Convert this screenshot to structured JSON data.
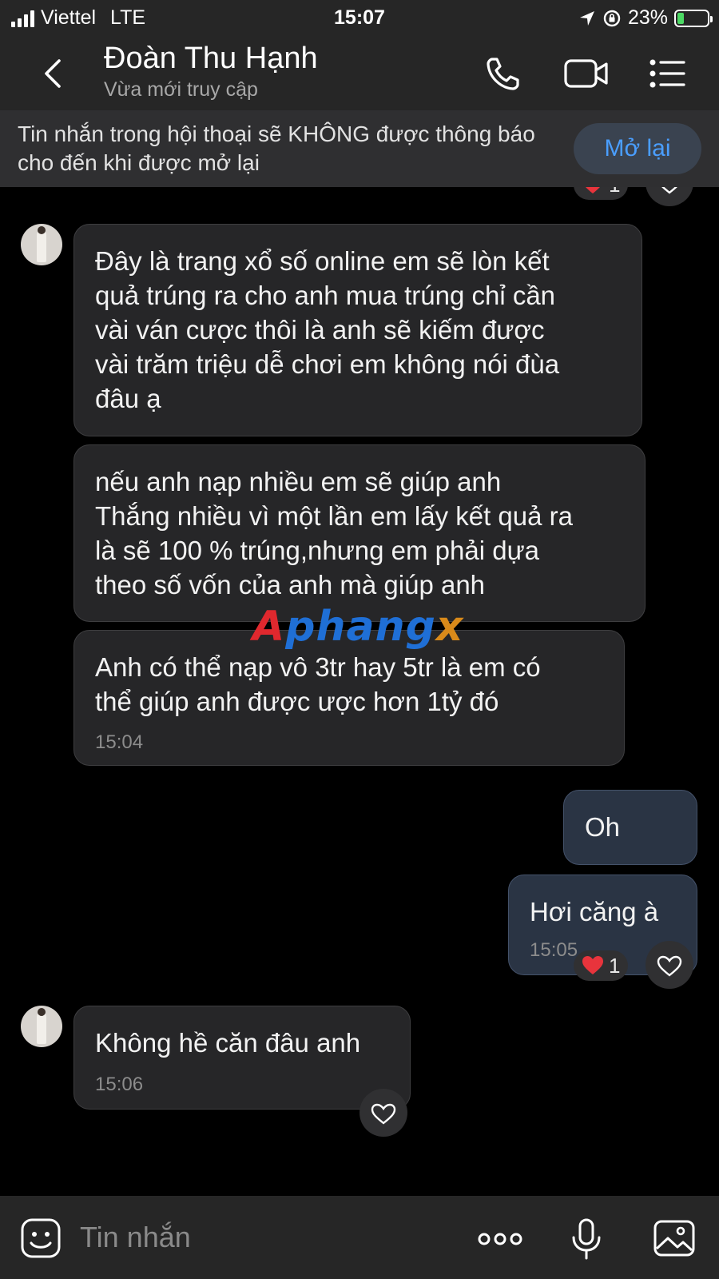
{
  "status_bar": {
    "carrier": "Viettel",
    "network": "LTE",
    "time": "15:07",
    "battery": "23%",
    "battery_level": 0.23,
    "battery_color": "#4cd964"
  },
  "header": {
    "contact_name": "Đoàn Thu Hạnh",
    "contact_status": "Vừa mới truy cập",
    "icons": [
      "back-icon",
      "phone-icon",
      "video-call-icon",
      "menu-icon"
    ]
  },
  "banner": {
    "text": "Tin nhắn trong hội thoại sẽ KHÔNG được thông báo cho đến khi được mở lại",
    "button_label": "Mở lại",
    "accent_color": "#4a9eff"
  },
  "messages": [
    {
      "direction": "incoming",
      "text": "Đây là trang xổ số online em sẽ lòn kết\nquả trúng ra cho anh mua trúng chỉ cần\nvài ván cược thôi là anh sẽ kiếm được\nvài trăm triệu dễ chơi em không nói đùa\nđâu ạ"
    },
    {
      "direction": "incoming",
      "text": "nếu anh nạp nhiều em sẽ giúp anh\nThắng nhiều vì một lần em lấy kết quả ra\nlà sẽ 100 % trúng,nhưng em phải dựa\ntheo số vốn của anh mà giúp anh"
    },
    {
      "direction": "incoming",
      "text": "Anh có thể nạp vô 3tr hay 5tr là em có\nthể giúp anh được ược hơn 1tỷ đó",
      "time": "15:04"
    },
    {
      "direction": "outgoing",
      "text": "Oh"
    },
    {
      "direction": "outgoing",
      "text": "Hơi căng à",
      "time": "15:05",
      "reaction_count": "1"
    },
    {
      "direction": "incoming",
      "text": "Không hề căn đâu anh",
      "time": "15:06"
    }
  ],
  "top_reaction_count": "1",
  "watermark": "Aphangx",
  "composer": {
    "placeholder": "Tin nhắn",
    "icons": [
      "sticker-icon",
      "more-icon",
      "microphone-icon",
      "image-icon"
    ]
  }
}
